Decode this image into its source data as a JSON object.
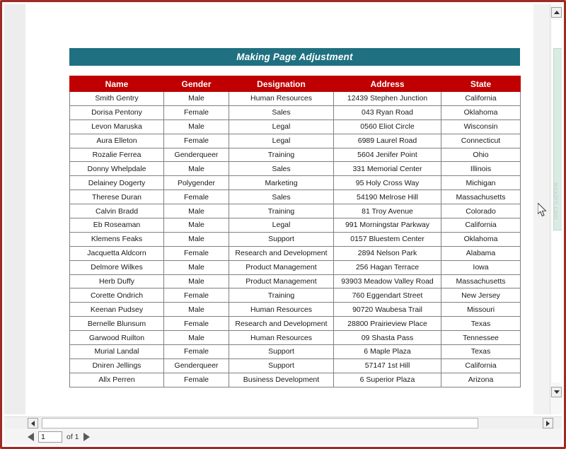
{
  "report": {
    "title": "Making Page Adjustment"
  },
  "table": {
    "columns": [
      "Name",
      "Gender",
      "Designation",
      "Address",
      "State"
    ],
    "rows": [
      [
        "Smith Gentry",
        "Male",
        "Human Resources",
        "12439 Stephen Junction",
        "California"
      ],
      [
        "Dorisa Pentony",
        "Female",
        "Sales",
        "043 Ryan Road",
        "Oklahoma"
      ],
      [
        "Levon Maruska",
        "Male",
        "Legal",
        "0560 Eliot Circle",
        "Wisconsin"
      ],
      [
        "Aura Elleton",
        "Female",
        "Legal",
        "6989 Laurel Road",
        "Connecticut"
      ],
      [
        "Rozalie Ferrea",
        "Genderqueer",
        "Training",
        "5604 Jenifer Point",
        "Ohio"
      ],
      [
        "Donny Whelpdale",
        "Male",
        "Sales",
        "331 Memorial Center",
        "Illinois"
      ],
      [
        "Delainey Dogerty",
        "Polygender",
        "Marketing",
        "95 Holy Cross Way",
        "Michigan"
      ],
      [
        "Therese Duran",
        "Female",
        "Sales",
        "54190 Melrose Hill",
        "Massachusetts"
      ],
      [
        "Calvin Bradd",
        "Male",
        "Training",
        "81 Troy Avenue",
        "Colorado"
      ],
      [
        "Eb Roseaman",
        "Male",
        "Legal",
        "991 Morningstar Parkway",
        "California"
      ],
      [
        "Klemens Feaks",
        "Male",
        "Support",
        "0157 Bluestem Center",
        "Oklahoma"
      ],
      [
        "Jacquetta Aldcorn",
        "Female",
        "Research and Development",
        "2894 Nelson Park",
        "Alabama"
      ],
      [
        "Delmore Wilkes",
        "Male",
        "Product Management",
        "256 Hagan Terrace",
        "Iowa"
      ],
      [
        "Herb Duffy",
        "Male",
        "Product Management",
        "93903 Meadow Valley Road",
        "Massachusetts"
      ],
      [
        "Corette Ondrich",
        "Female",
        "Training",
        "760 Eggendart Street",
        "New Jersey"
      ],
      [
        "Keenan Pudsey",
        "Male",
        "Human Resources",
        "90720 Waubesa Trail",
        "Missouri"
      ],
      [
        "Bernelle Blunsum",
        "Female",
        "Research and Development",
        "28800 Prairieview Place",
        "Texas"
      ],
      [
        "Garwood Ruilton",
        "Male",
        "Human Resources",
        "09 Shasta Pass",
        "Tennessee"
      ],
      [
        "Murial Landal",
        "Female",
        "Support",
        "6 Maple Plaza",
        "Texas"
      ],
      [
        "Dniren Jellings",
        "Genderqueer",
        "Support",
        "57147 1st Hill",
        "California"
      ],
      [
        "Allx Perren",
        "Female",
        "Business Development",
        "6 Superior Plaza",
        "Arizona"
      ]
    ]
  },
  "statusbar": {
    "page_value": "1",
    "of_label": "of 1"
  },
  "watermark": {
    "text": "wsxdrn.com"
  },
  "colors": {
    "title_banner": "#1F7080",
    "table_header": "#C00000",
    "frame_border": "#9E2A26",
    "scroll_thumb": "#D9ECE4"
  }
}
